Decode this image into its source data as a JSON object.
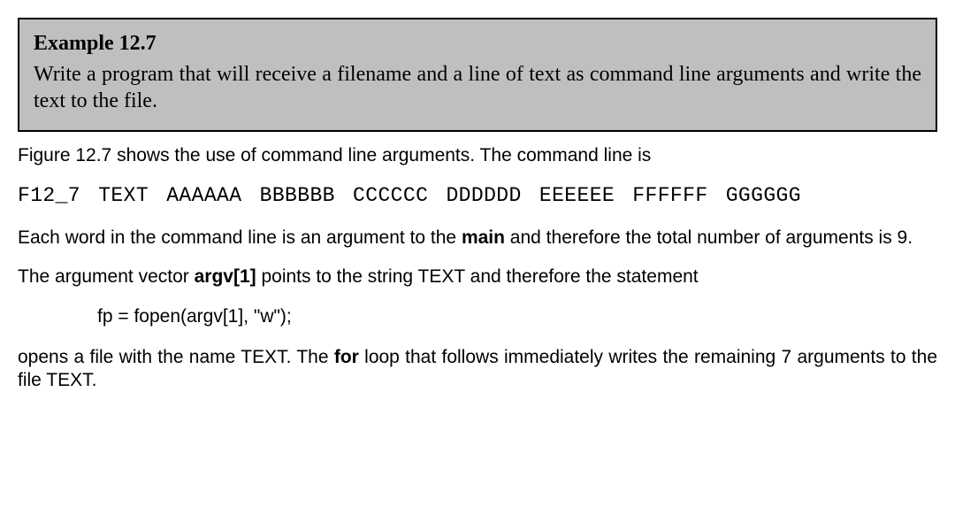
{
  "example": {
    "title": "Example 12.7",
    "prompt": "Write a program that will receive a filename and a line of text as command line arguments and write the text to the file."
  },
  "body": {
    "p1": "Figure 12.7 shows the use of command line arguments.  The command line is",
    "cmd": "F12_7 TEXT AAAAAA BBBBBB CCCCCC DDDDDD EEEEEE FFFFFF GGGGGG",
    "p2_a": "Each word in the command line is an argument to the ",
    "p2_bold": "main",
    "p2_b": " and therefore the total number of arguments is 9.",
    "p3_a": "The argument vector ",
    "p3_bold": "argv[1]",
    "p3_b": " points to the string TEXT and therefore the statement",
    "code": "fp = fopen(argv[1], \"w\");",
    "p4_a": "opens a file with the name TEXT.  The ",
    "p4_bold": "for",
    "p4_b": " loop that follows immediately writes the remaining 7 arguments to the file TEXT."
  }
}
